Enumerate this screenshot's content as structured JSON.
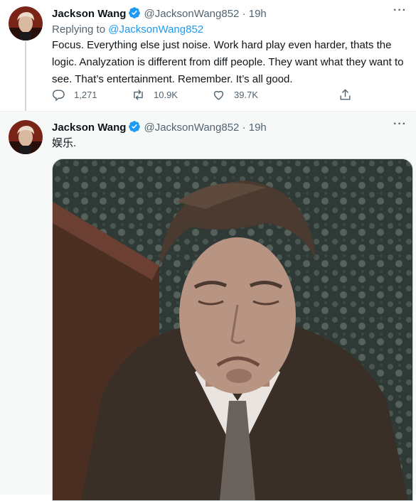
{
  "tweets": [
    {
      "author_name": "Jackson Wang",
      "handle": "@JacksonWang852",
      "separator": "·",
      "time": "19h",
      "replying_prefix": "Replying to",
      "replying_to": "@JacksonWang852",
      "text": "Focus. Everything else just noise. Work hard play even harder, thats the logic. Analyzation is different from diff people. They want what they want to see. That’s entertainment. Remember. It’s all good.",
      "actions": {
        "reply_count": "1,271",
        "retweet_count": "10.9K",
        "like_count": "39.7K"
      }
    },
    {
      "author_name": "Jackson Wang",
      "handle": "@JacksonWang852",
      "separator": "·",
      "time": "19h",
      "text": "娱乐.",
      "media": {
        "type": "gif-image"
      }
    }
  ],
  "more_label": "···",
  "colors": {
    "accent": "#1d9bf0",
    "secondary_text": "#536471",
    "primary_text": "#0f1419",
    "verified_badge": "#1d9bf0",
    "highlight_bg": "#f7f9f9"
  },
  "icons": [
    "verified-badge-icon",
    "reply-icon",
    "retweet-icon",
    "like-icon",
    "share-icon",
    "more-icon"
  ]
}
